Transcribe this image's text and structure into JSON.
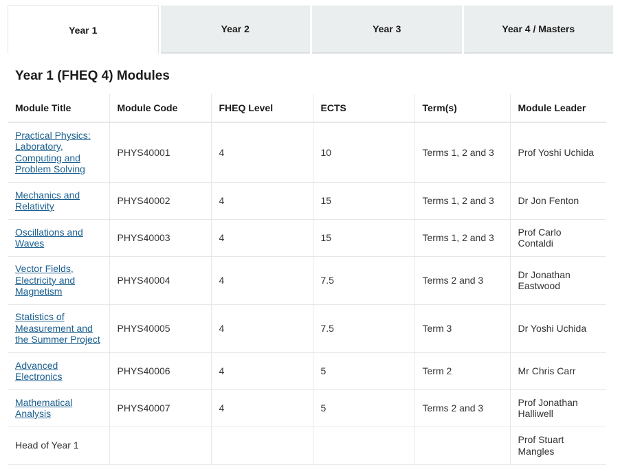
{
  "tabs": [
    {
      "label": "Year 1"
    },
    {
      "label": "Year 2"
    },
    {
      "label": "Year 3"
    },
    {
      "label": "Year 4 / Masters"
    }
  ],
  "section_title": "Year 1 (FHEQ 4) Modules",
  "table": {
    "headers": [
      "Module Title",
      "Module Code",
      "FHEQ Level",
      "ECTS",
      "Term(s)",
      "Module Leader"
    ],
    "rows": [
      {
        "title": "Practical Physics: Laboratory, Computing and Problem Solving",
        "code": "PHYS40001",
        "level": "4",
        "ects": "10",
        "terms": "Terms 1, 2 and 3",
        "leader": "Prof Yoshi Uchida"
      },
      {
        "title": "Mechanics and Relativity",
        "code": "PHYS40002",
        "level": "4",
        "ects": "15",
        "terms": "Terms 1, 2 and 3",
        "leader": "Dr Jon Fenton"
      },
      {
        "title": "Oscillations and Waves",
        "code": "PHYS40003",
        "level": "4",
        "ects": "15",
        "terms": "Terms 1, 2 and 3",
        "leader": "Prof Carlo Contaldi"
      },
      {
        "title": "Vector Fields, Electricity and Magnetism",
        "code": "PHYS40004",
        "level": "4",
        "ects": "7.5",
        "terms": "Terms 2 and 3",
        "leader": "Dr Jonathan Eastwood"
      },
      {
        "title": "Statistics of Measurement and the Summer Project",
        "code": "PHYS40005",
        "level": "4",
        "ects": "7.5",
        "terms": "Term 3",
        "leader": "Dr Yoshi Uchida"
      },
      {
        "title": "Advanced Electronics",
        "code": "PHYS40006",
        "level": "4",
        "ects": "5",
        "terms": "Term 2",
        "leader": "Mr Chris Carr"
      },
      {
        "title": "Mathematical Analysis",
        "code": "PHYS40007",
        "level": "4",
        "ects": "5",
        "terms": "Terms 2 and 3",
        "leader": "Prof Jonathan Halliwell"
      }
    ],
    "footer_row": {
      "title": "Head of Year 1",
      "leader": "Prof Stuart Mangles"
    }
  }
}
